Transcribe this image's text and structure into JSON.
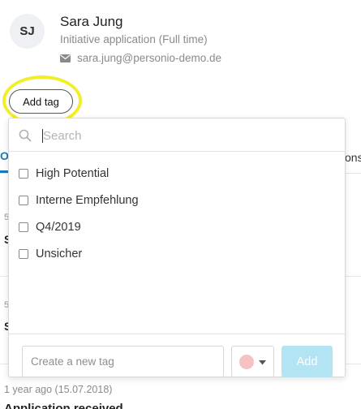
{
  "profile": {
    "initials": "SJ",
    "name": "Sara Jung",
    "subtitle": "Initiative application (Full time)",
    "email": "sara.jung@personio-demo.de"
  },
  "add_tag_button": {
    "label": "Add tag"
  },
  "tag_dropdown": {
    "search_placeholder": "Search",
    "tags": [
      {
        "label": "High Potential",
        "checked": false
      },
      {
        "label": "Interne Empfehlung",
        "checked": false
      },
      {
        "label": "Q4/2019",
        "checked": false
      },
      {
        "label": "Unsicher",
        "checked": false
      }
    ],
    "new_tag_placeholder": "Create a new tag",
    "selected_color": "#f6c3c3",
    "add_label": "Add"
  },
  "background": {
    "tab_left_fragment": "O",
    "tab_right_fragment": "ons",
    "row_fragment_1": "5",
    "row_fragment_1_title": "S",
    "row_fragment_2": "5",
    "row_fragment_2_title": "S",
    "timestamp": "1 year ago (15.07.2018)",
    "bottom_title": "Application received"
  },
  "colors": {
    "accent": "#1a7ab8",
    "highlight": "#f2ee2a",
    "add_button_disabled": "#b3e4f3"
  }
}
